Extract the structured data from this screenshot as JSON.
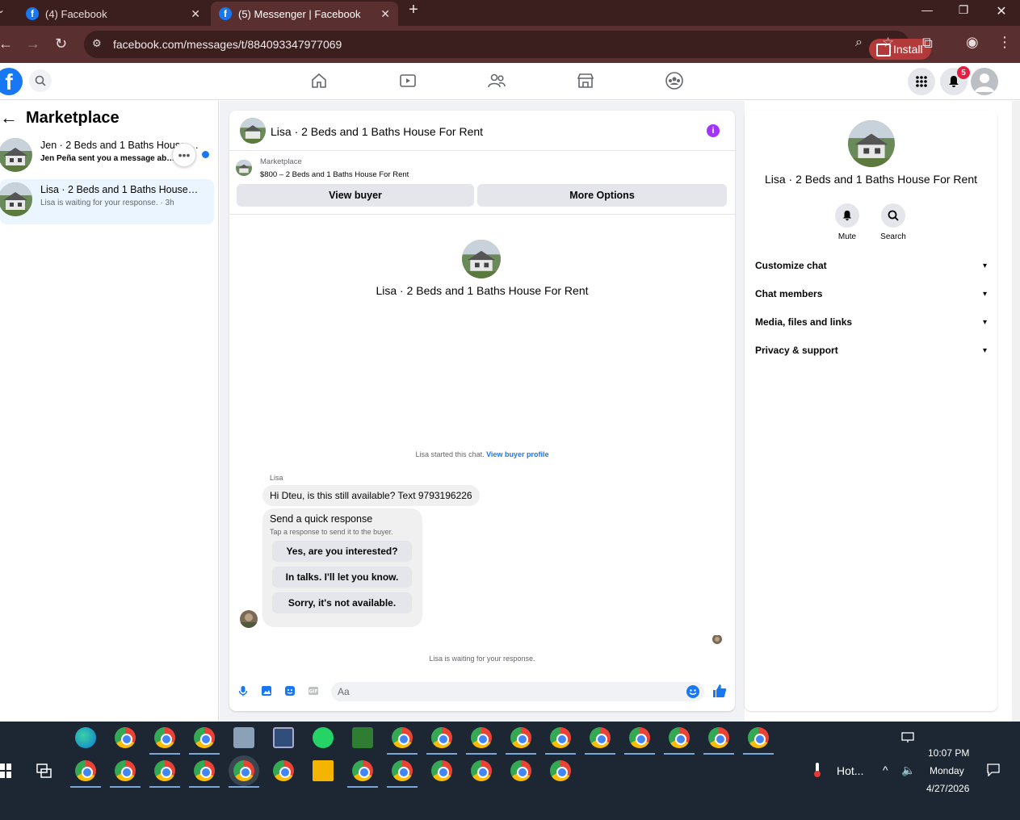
{
  "browser": {
    "tabs": [
      {
        "title": "(4) Facebook",
        "active": false
      },
      {
        "title": "(5) Messenger | Facebook",
        "active": true
      }
    ],
    "url": "facebook.com/messages/t/884093347977069",
    "install_label": "Install"
  },
  "fb_header": {
    "notification_count": "5"
  },
  "sidebar": {
    "title": "Marketplace",
    "conversations": [
      {
        "title": "Jen · 2 Beds and 1 Baths House F...",
        "subtitle": "Jen Peña sent you a message abou...",
        "unread": true
      },
      {
        "title": "Lisa · 2 Beds and 1 Baths House Fo...",
        "subtitle": "Lisa is waiting for your response. · 3h",
        "selected": true
      }
    ]
  },
  "chat": {
    "title": "Lisa · 2 Beds and 1 Baths House For Rent",
    "marketplace_label": "Marketplace",
    "listing": "$800 – 2 Beds and 1 Baths House For Rent",
    "view_buyer_label": "View buyer",
    "more_options_label": "More Options",
    "profile_name": "Lisa · 2 Beds and 1 Baths House For Rent",
    "started_text": "Lisa started this chat.",
    "view_buyer_profile_label": "View buyer profile",
    "sender_name": "Lisa",
    "message": "Hi Dteu, is this still available? Text 9793196226",
    "quick_response": {
      "heading": "Send a quick response",
      "subheading": "Tap a response to send it to the buyer.",
      "options": [
        "Yes, are you interested?",
        "In talks. I'll let you know.",
        "Sorry, it's not available."
      ]
    },
    "waiting_text": "Lisa is waiting for your response.",
    "composer_placeholder": "Aa"
  },
  "details": {
    "name": "Lisa · 2 Beds and 1 Baths House For Rent",
    "actions": [
      "Mute",
      "Search"
    ],
    "sections": [
      "Customize chat",
      "Chat members",
      "Media, files and links",
      "Privacy & support"
    ]
  },
  "taskbar": {
    "weather": "Hot...",
    "time": "10:07 PM",
    "day": "Monday",
    "date": "4/27/2026"
  }
}
